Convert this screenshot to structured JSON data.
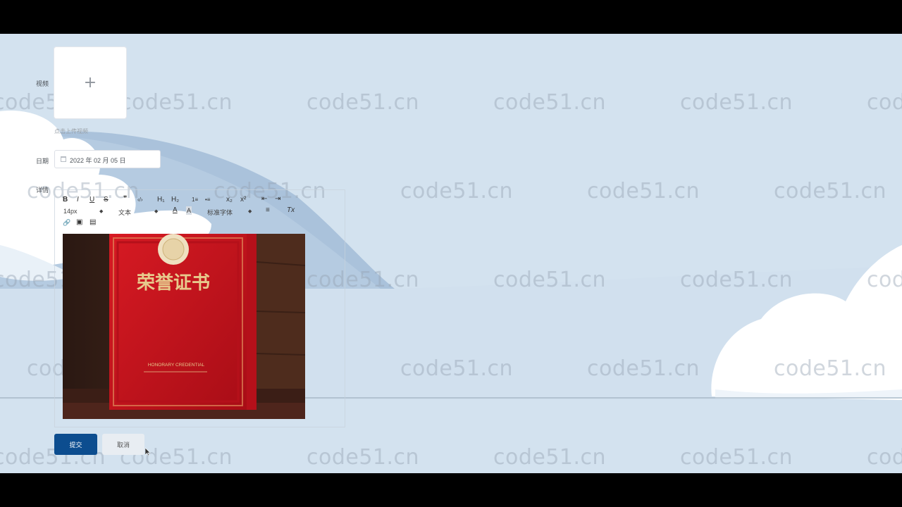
{
  "form": {
    "video_label": "视频",
    "upload_plus": "+",
    "upload_hint": "点击上传视频",
    "date_label": "日期",
    "date_value": "2022 年 02 月 05 日",
    "detail_label": "详情"
  },
  "toolbar": {
    "bold": "B",
    "italic": "I",
    "underline": "U",
    "strike": "S",
    "quote": "❞",
    "code": "‹/›",
    "h1": "H₁",
    "h2": "H₂",
    "ordered_list": "1≡",
    "bullet_list": "•≡",
    "subscript": "x₂",
    "superscript": "x²",
    "outdent": "⇤",
    "indent": "⇥",
    "font_size": "14px",
    "paragraph": "文本",
    "font_color": "A",
    "bg_color": "A",
    "font_family": "标准字体",
    "align": "≡",
    "clear_format": "Tx",
    "link": "🔗",
    "image": "▣",
    "video": "▤"
  },
  "certificate": {
    "title": "荣誉证书",
    "subtitle": "HONORARY CREDENTIAL",
    "colors": {
      "cover": "#c8141e",
      "gold": "#e7c98c",
      "wood": "#4a2a1c"
    }
  },
  "buttons": {
    "submit": "提交",
    "cancel": "取消"
  },
  "watermark": "code51.cn",
  "colors": {
    "background": "#d3e2ef",
    "primary": "#0c4d8f"
  }
}
